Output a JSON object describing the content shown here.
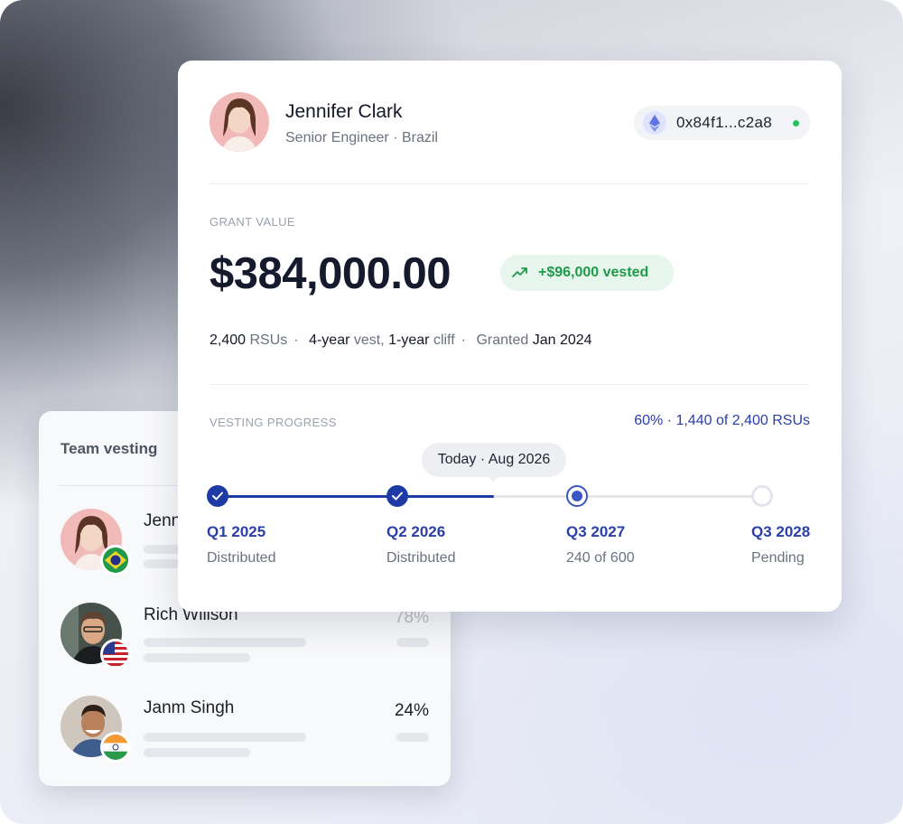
{
  "team": {
    "title": "Team vesting",
    "members": [
      {
        "name": "Jennifer Clark",
        "visible_name": "Jenn",
        "pct": "",
        "flag": "brazil-flag"
      },
      {
        "name": "Rich Willson",
        "pct": "78%",
        "flag": "usa-flag"
      },
      {
        "name": "Janm Singh",
        "pct": "24%",
        "flag": "india-flag"
      }
    ]
  },
  "employee": {
    "name": "Jennifer Clark",
    "role": "Senior Engineer · Brazil",
    "wallet": "0x84f1...c2a8",
    "wallet_icon": "ethereum-icon",
    "wallet_status_color": "#27c25a"
  },
  "grant": {
    "label": "GRANT VALUE",
    "value": "$384,000.00",
    "vested_badge": "+$96,000 vested",
    "rsus": "2,400",
    "rsus_unit": "RSUs",
    "vest_years": "4-year",
    "vest_word": "vest,",
    "cliff_years": "1-year",
    "cliff_word": "cliff",
    "granted_word": "Granted",
    "granted_date": "Jan 2024"
  },
  "vesting": {
    "label": "VESTING PROGRESS",
    "summary": "60% · 1,440 of 2,400 RSUs",
    "progress_fraction": 0.6,
    "today": "Today · Aug 2026",
    "milestones": [
      {
        "quarter": "Q1 2025",
        "status": "Distributed",
        "state": "done"
      },
      {
        "quarter": "Q2 2026",
        "status": "Distributed",
        "state": "done"
      },
      {
        "quarter": "Q3 2027",
        "status": "240 of 600",
        "state": "current"
      },
      {
        "quarter": "Q3 2028",
        "status": "Pending",
        "state": "pending"
      }
    ]
  },
  "colors": {
    "accent": "#1e3aa5",
    "vested_green": "#1f9a48",
    "vested_bg": "#e7f6ec"
  }
}
